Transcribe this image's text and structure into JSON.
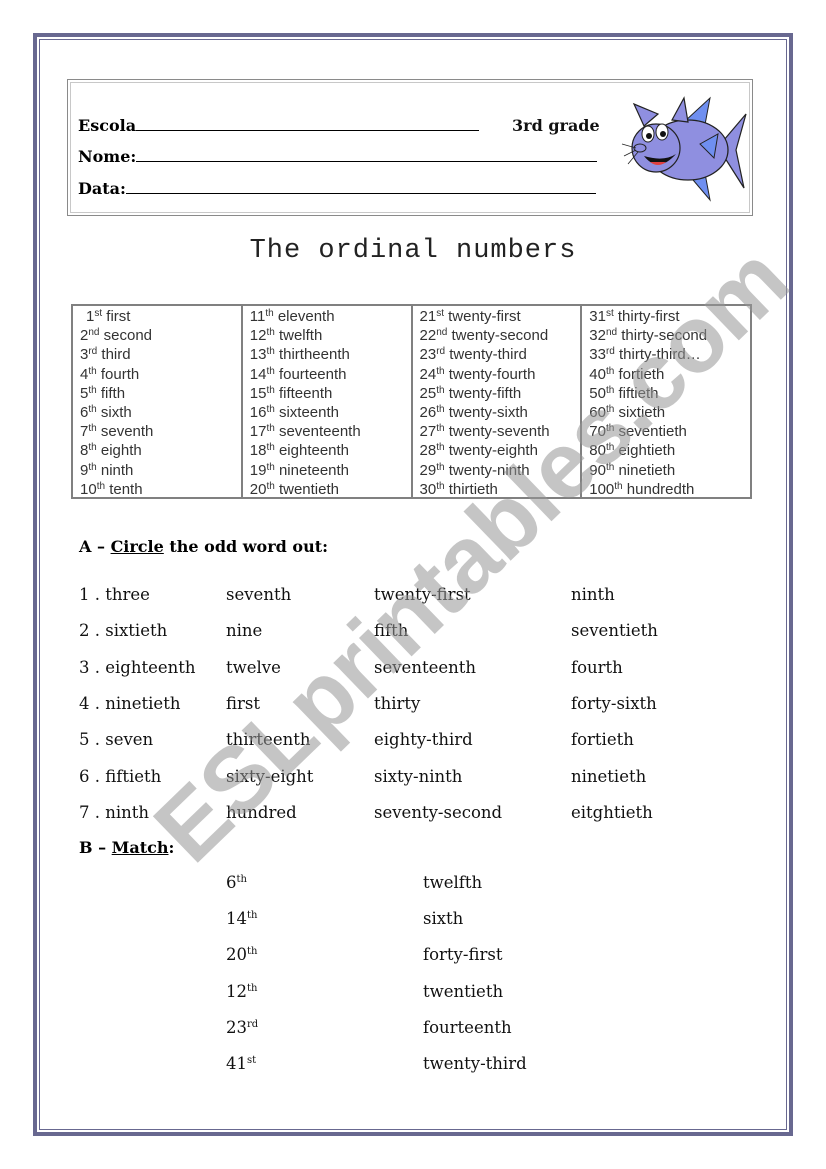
{
  "header": {
    "school_label": "Escola",
    "name_label": "Nome:",
    "date_label": "Data:",
    "grade": "3rd grade",
    "illustration": "cartoon-fish"
  },
  "colors": {
    "page_border": "#686890",
    "table_border": "#808080",
    "fish_body": "#8f8fe0",
    "fish_fin": "#6f8ff0",
    "watermark": "#b4b4b4"
  },
  "title": "The ordinal numbers",
  "ordinal_table": {
    "columns": [
      [
        {
          "num": "1",
          "suffix": "st",
          "word": "first"
        },
        {
          "num": "2",
          "suffix": "nd",
          "word": "second"
        },
        {
          "num": "3",
          "suffix": "rd",
          "word": "third"
        },
        {
          "num": "4",
          "suffix": "th",
          "word": "fourth"
        },
        {
          "num": "5",
          "suffix": "th",
          "word": "fifth"
        },
        {
          "num": "6",
          "suffix": "th",
          "word": "sixth"
        },
        {
          "num": "7",
          "suffix": "th",
          "word": "seventh"
        },
        {
          "num": "8",
          "suffix": "th",
          "word": "eighth"
        },
        {
          "num": "9",
          "suffix": "th",
          "word": "ninth"
        },
        {
          "num": "10",
          "suffix": "th",
          "word": "tenth"
        }
      ],
      [
        {
          "num": "11",
          "suffix": "th",
          "word": "eleventh"
        },
        {
          "num": "12",
          "suffix": "th",
          "word": "twelfth"
        },
        {
          "num": "13",
          "suffix": "th",
          "word": "thirtheenth"
        },
        {
          "num": "14",
          "suffix": "th",
          "word": "fourteenth"
        },
        {
          "num": "15",
          "suffix": "th",
          "word": "fifteenth"
        },
        {
          "num": "16",
          "suffix": "th",
          "word": "sixteenth"
        },
        {
          "num": "17",
          "suffix": "th",
          "word": "seventeenth"
        },
        {
          "num": "18",
          "suffix": "th",
          "word": "eighteenth"
        },
        {
          "num": "19",
          "suffix": "th",
          "word": "nineteenth"
        },
        {
          "num": "20",
          "suffix": "th",
          "word": "twentieth"
        }
      ],
      [
        {
          "num": "21",
          "suffix": "st",
          "word": "twenty-first"
        },
        {
          "num": "22",
          "suffix": "nd",
          "word": "twenty-second"
        },
        {
          "num": "23",
          "suffix": "rd",
          "word": "twenty-third"
        },
        {
          "num": "24",
          "suffix": "th",
          "word": "twenty-fourth"
        },
        {
          "num": "25",
          "suffix": "th",
          "word": "twenty-fifth"
        },
        {
          "num": "26",
          "suffix": "th",
          "word": "twenty-sixth"
        },
        {
          "num": "27",
          "suffix": "th",
          "word": "twenty-seventh"
        },
        {
          "num": "28",
          "suffix": "th",
          "word": "twenty-eighth"
        },
        {
          "num": "29",
          "suffix": "th",
          "word": "twenty-ninth"
        },
        {
          "num": "30",
          "suffix": "th",
          "word": "thirtieth"
        }
      ],
      [
        {
          "num": "31",
          "suffix": "st",
          "word": "thirty-first"
        },
        {
          "num": "32",
          "suffix": "nd",
          "word": "thirty-second"
        },
        {
          "num": "33",
          "suffix": "rd",
          "word": "thirty-third…"
        },
        {
          "num": "40",
          "suffix": "th",
          "word": "fortieth"
        },
        {
          "num": "50",
          "suffix": "th",
          "word": "fiftieth"
        },
        {
          "num": "60",
          "suffix": "th",
          "word": "sixtieth"
        },
        {
          "num": "70",
          "suffix": "th",
          "word": "seventieth"
        },
        {
          "num": "80",
          "suffix": "th",
          "word": "eightieth"
        },
        {
          "num": "90",
          "suffix": "th",
          "word": "ninetieth"
        },
        {
          "num": "100",
          "suffix": "th",
          "word": "hundredth"
        }
      ]
    ]
  },
  "section_a": {
    "prefix": "A – ",
    "verb": "Circle",
    "rest": " the odd word out:",
    "rows": [
      [
        "1 . three",
        "seventh",
        "twenty-first",
        "ninth"
      ],
      [
        "2 . sixtieth",
        "nine",
        "fifth",
        "seventieth"
      ],
      [
        "3 . eighteenth",
        "twelve",
        "seventeenth",
        "fourth"
      ],
      [
        "4 . ninetieth",
        "first",
        "thirty",
        "forty-sixth"
      ],
      [
        "5 . seven",
        "thirteenth",
        "eighty-third",
        "fortieth"
      ],
      [
        "6 . fiftieth",
        "sixty-eight",
        "sixty-ninth",
        "ninetieth"
      ],
      [
        "7 . ninth",
        "hundred",
        "seventy-second",
        "eitghtieth"
      ]
    ]
  },
  "section_b": {
    "prefix": "B – ",
    "verb": "Match",
    "rest": ":",
    "rows": [
      {
        "num": "6",
        "suffix": "th",
        "word": "twelfth"
      },
      {
        "num": "14",
        "suffix": "th",
        "word": "sixth"
      },
      {
        "num": "20",
        "suffix": "th",
        "word": "forty-first"
      },
      {
        "num": "12",
        "suffix": "th",
        "word": "twentieth"
      },
      {
        "num": "23",
        "suffix": "rd",
        "word": "fourteenth"
      },
      {
        "num": "41",
        "suffix": "st",
        "word": "twenty-third"
      }
    ]
  },
  "watermark": "ESLprintables.com"
}
